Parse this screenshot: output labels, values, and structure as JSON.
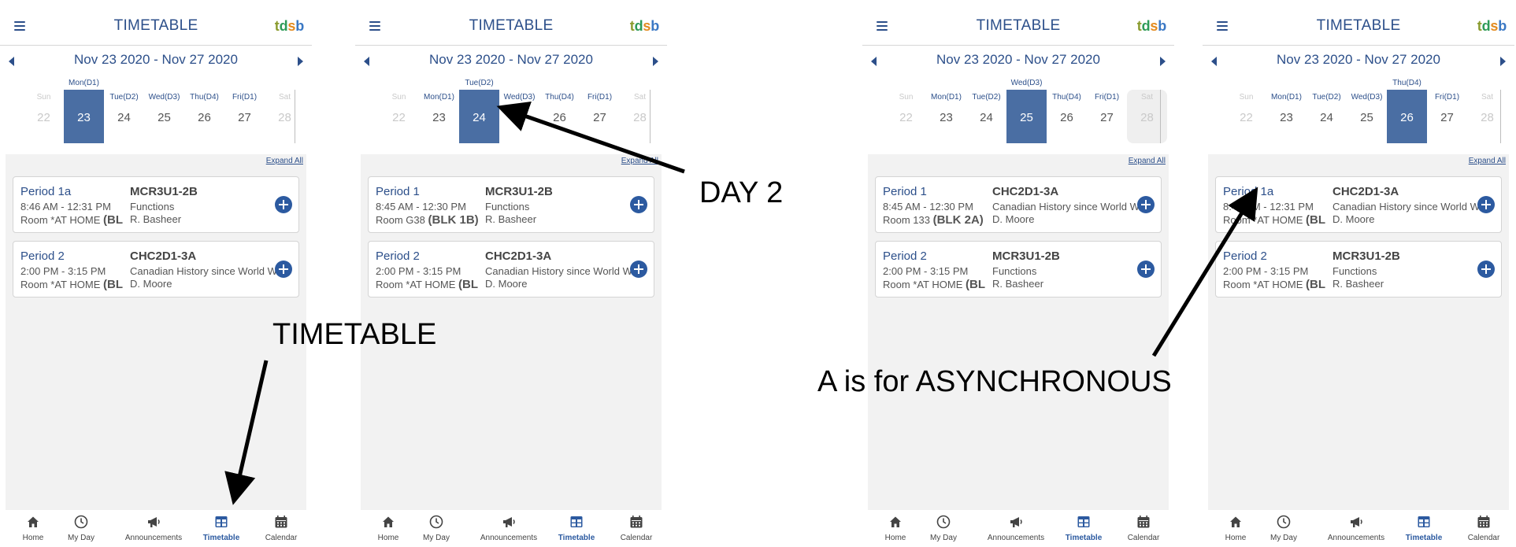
{
  "app": {
    "title": "TIMETABLE",
    "logo": [
      "t",
      "d",
      "s",
      "b"
    ],
    "week": "Nov 23 2020 - Nov 27 2020",
    "expand_all": "Expand All"
  },
  "day_headers": [
    "Sun",
    "Mon(D1)",
    "Tue(D2)",
    "Wed(D3)",
    "Thu(D4)",
    "Fri(D1)",
    "Sat"
  ],
  "day_numbers": [
    "22",
    "23",
    "24",
    "25",
    "26",
    "27",
    "28"
  ],
  "tabs": [
    "Home",
    "My Day",
    "Announcements",
    "Timetable",
    "Calendar"
  ],
  "icons": {
    "menu": "menu-icon",
    "prev": "chevron-left-icon",
    "next": "chevron-right-icon",
    "add": "plus-circle-icon",
    "home": "home-icon",
    "my_day": "clock-icon",
    "announcements": "megaphone-icon",
    "timetable": "table-icon",
    "calendar": "calendar-icon"
  },
  "colors": {
    "primary": "#2c4f8a",
    "selected_day": "#4a6ea3",
    "plus": "#2c5aa0",
    "content_bg": "#f2f2f2"
  },
  "screens": [
    {
      "selected_day": "Mon(D1)",
      "classes": [
        {
          "period": "Period 1a",
          "time": "8:46 AM - 12:31 PM",
          "room": "Room *AT HOME",
          "block": "(BL",
          "code": "MCR3U1-2B",
          "course": "Functions",
          "teacher": "R. Basheer"
        },
        {
          "period": "Period 2",
          "time": "2:00 PM - 3:15 PM",
          "room": "Room *AT HOME",
          "block": "(BL",
          "code": "CHC2D1-3A",
          "course": "Canadian History since World War I",
          "teacher": "D. Moore"
        }
      ]
    },
    {
      "selected_day": "Tue(D2)",
      "classes": [
        {
          "period": "Period 1",
          "time": "8:45 AM - 12:30 PM",
          "room": "Room G38",
          "block": "(BLK 1B)",
          "code": "MCR3U1-2B",
          "course": "Functions",
          "teacher": "R. Basheer"
        },
        {
          "period": "Period 2",
          "time": "2:00 PM - 3:15 PM",
          "room": "Room *AT HOME",
          "block": "(BL",
          "code": "CHC2D1-3A",
          "course": "Canadian History since World War I",
          "teacher": "D. Moore"
        }
      ]
    },
    {
      "selected_day": "Wed(D3)",
      "classes": [
        {
          "period": "Period 1",
          "time": "8:45 AM - 12:30 PM",
          "room": "Room 133",
          "block": "(BLK 2A)",
          "code": "CHC2D1-3A",
          "course": "Canadian History since World War I",
          "teacher": "D. Moore"
        },
        {
          "period": "Period 2",
          "time": "2:00 PM - 3:15 PM",
          "room": "Room *AT HOME",
          "block": "(BL",
          "code": "MCR3U1-2B",
          "course": "Functions",
          "teacher": "R. Basheer"
        }
      ]
    },
    {
      "selected_day": "Thu(D4)",
      "classes": [
        {
          "period": "Period 1a",
          "time": "8:46 AM - 12:31 PM",
          "room": "Room *AT HOME",
          "block": "(BL",
          "code": "CHC2D1-3A",
          "course": "Canadian History since World War I",
          "teacher": "D. Moore"
        },
        {
          "period": "Period 2",
          "time": "2:00 PM - 3:15 PM",
          "room": "Room *AT HOME",
          "block": "(BL",
          "code": "MCR3U1-2B",
          "course": "Functions",
          "teacher": "R. Basheer"
        }
      ]
    }
  ],
  "annotations": {
    "day2": "DAY 2",
    "timetable": "TIMETABLE",
    "async": "A is for ASYNCHRONOUS"
  }
}
